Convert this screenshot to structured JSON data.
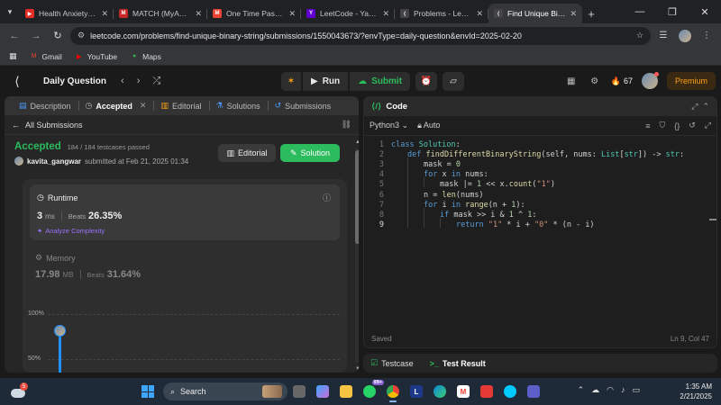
{
  "browser": {
    "tabs": [
      {
        "title": "Health Anxiety - Si",
        "fav_color": "#e52d27",
        "fav_glyph": "▶"
      },
      {
        "title": "MATCH (MyAnato",
        "fav_color": "#c62828",
        "fav_glyph": "M"
      },
      {
        "title": "One Time Passwo",
        "fav_color": "#ea4335",
        "fav_glyph": "M"
      },
      {
        "title": "LeetCode - Yahoo",
        "fav_color": "#6001d2",
        "fav_glyph": "Y"
      },
      {
        "title": "Problems - LeetCo",
        "fav_color": "#444444",
        "fav_glyph": "⟨"
      },
      {
        "title": "Find Unique Binar",
        "fav_color": "#444444",
        "fav_glyph": "⟨"
      }
    ],
    "url": "leetcode.com/problems/find-unique-binary-string/submissions/1550043673/?envType=daily-question&envId=2025-02-20",
    "bookmarks": [
      {
        "label": "Gmail",
        "color": "#ea4335",
        "glyph": "M"
      },
      {
        "label": "YouTube",
        "color": "#ff0000",
        "glyph": "▶"
      },
      {
        "label": "Maps",
        "color": "#34a853",
        "glyph": "●"
      }
    ]
  },
  "lc_nav": {
    "daily_question": "Daily Question",
    "run_label": "Run",
    "submit_label": "Submit",
    "streak": "67",
    "premium": "Premium"
  },
  "left_tabs": [
    {
      "label": "Description",
      "icon": "file-icon",
      "glyph": "▤"
    },
    {
      "label": "Accepted",
      "icon": "clock-icon",
      "glyph": "◷"
    },
    {
      "label": "Editorial",
      "icon": "book-icon",
      "glyph": "▥"
    },
    {
      "label": "Solutions",
      "icon": "flask-icon",
      "glyph": "⚗"
    },
    {
      "label": "Submissions",
      "icon": "history-icon",
      "glyph": "↺"
    }
  ],
  "submission": {
    "all_submissions": "All Submissions",
    "status": "Accepted",
    "testcases": "184 / 184 testcases passed",
    "user": "kavita_gangwar",
    "submitted_at": "submitted at Feb 21, 2025 01:34",
    "editorial_btn": "Editorial",
    "solution_btn": "Solution"
  },
  "runtime": {
    "title": "Runtime",
    "value": "3",
    "unit": "ms",
    "beats_label": "Beats",
    "beats": "26.35%",
    "analyze": "Analyze Complexity"
  },
  "memory": {
    "title": "Memory",
    "value": "17.98",
    "unit": "MB",
    "beats_label": "Beats",
    "beats": "31.64%"
  },
  "distribution_chart": {
    "y_ticks": [
      "100%",
      "50%"
    ]
  },
  "code_panel": {
    "title": "Code",
    "language": "Python3",
    "mode": "Auto",
    "status_left": "Saved",
    "status_right": "Ln 9, Col 47"
  },
  "code_lines": [
    {
      "n": "1"
    },
    {
      "n": "2"
    },
    {
      "n": "3"
    },
    {
      "n": "4"
    },
    {
      "n": "5"
    },
    {
      "n": "6"
    },
    {
      "n": "7"
    },
    {
      "n": "8"
    },
    {
      "n": "9"
    }
  ],
  "code_text": {
    "l1a": "class ",
    "l1b": "Solution",
    "l1c": ":",
    "l2a": "def ",
    "l2b": "findDifferentBinaryString",
    "l2c": "(self, nums: ",
    "l2d": "List",
    "l2e": "[",
    "l2f": "str",
    "l2g": "]) -> ",
    "l2h": "str",
    "l2i": ":",
    "l3a": "mask = ",
    "l3b": "0",
    "l4a": "for ",
    "l4b": "x ",
    "l4c": "in ",
    "l4d": "nums:",
    "l5a": "mask |= ",
    "l5b": "1",
    "l5c": " << x.",
    "l5d": "count",
    "l5e": "(",
    "l5f": "\"1\"",
    "l5g": ")",
    "l6a": "n = ",
    "l6b": "len",
    "l6c": "(nums)",
    "l7a": "for ",
    "l7b": "i ",
    "l7c": "in ",
    "l7d": "range",
    "l7e": "(n + ",
    "l7f": "1",
    "l7g": "):",
    "l8a": "if ",
    "l8b": "mask >> i & ",
    "l8c": "1",
    "l8d": " ^ ",
    "l8e": "1",
    "l8f": ":",
    "l9a": "return ",
    "l9b": "\"1\"",
    "l9c": " * i + ",
    "l9d": "\"0\"",
    "l9e": " * (n - i)"
  },
  "bottom_panel": {
    "testcase": "Testcase",
    "test_result": "Test Result"
  },
  "taskbar": {
    "weather_badge": "5",
    "search": "Search",
    "notif_badge": "99+",
    "time": "1:35 AM",
    "date": "2/21/2025"
  },
  "colors": {
    "accepted": "#2cbb5d",
    "premium": "#ffa116",
    "chart_bar": "#1e90ff"
  }
}
